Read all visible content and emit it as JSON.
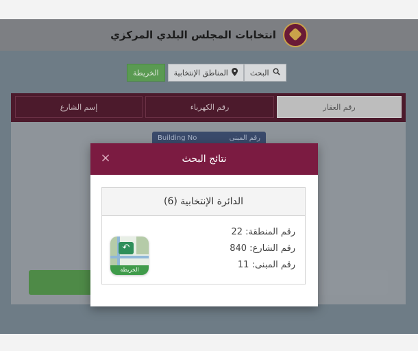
{
  "header": {
    "title": "انتخابات المجلس البلدي المركزي"
  },
  "search_bar": {
    "search_label": "البحث",
    "districts_label": "المناطق الإنتخابية",
    "map_label": "الخريطة"
  },
  "tabs": [
    {
      "label": "رقم العقار",
      "active": true
    },
    {
      "label": "رقم الكهرباء",
      "active": false
    },
    {
      "label": "إسم الشارع",
      "active": false
    }
  ],
  "building_box": {
    "label_ar": "رقم المبنى",
    "label_en": "Building No"
  },
  "modal": {
    "title": "نتائج البحث",
    "close": "×",
    "result": {
      "heading": "الدائرة الإنتخابية  (6)",
      "lines": [
        "رقم المنطقة: 22",
        "رقم الشارع: 840",
        "رقم المبنى: 11"
      ],
      "map_icon_label": "الخريطة"
    }
  },
  "colors": {
    "maroon": "#7b1b41",
    "green": "#5a9a52",
    "overlay": "#6e7c86"
  }
}
